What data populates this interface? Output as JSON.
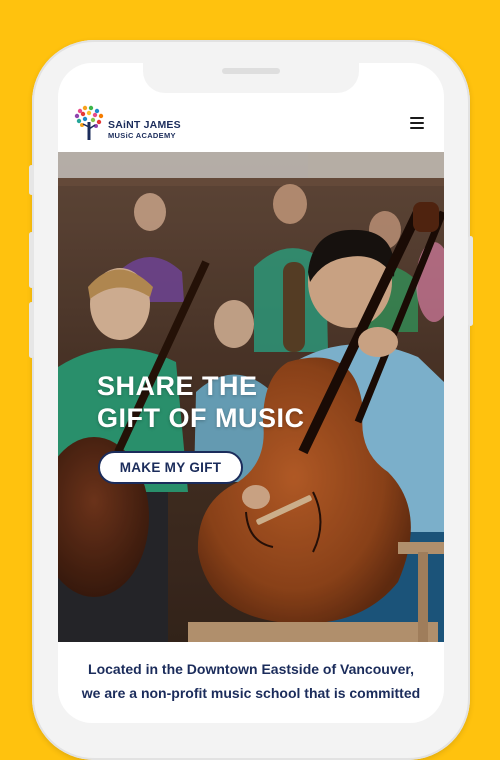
{
  "brand": {
    "name_line1": "SAiNT JAMES",
    "name_line2": "MUSiC ACADEMY"
  },
  "header": {
    "menu_icon": "hamburger-menu-icon"
  },
  "hero": {
    "title_line1": "SHARE THE",
    "title_line2": "GIFT OF MUSIC",
    "cta_label": "MAKE MY GIFT"
  },
  "intro": {
    "line1": "Located in the Downtown Eastside of Vancouver,",
    "line2": "we are a non-profit music school that is committed"
  },
  "colors": {
    "background": "#FFC20E",
    "brand_navy": "#1b2c5b",
    "white": "#ffffff"
  }
}
